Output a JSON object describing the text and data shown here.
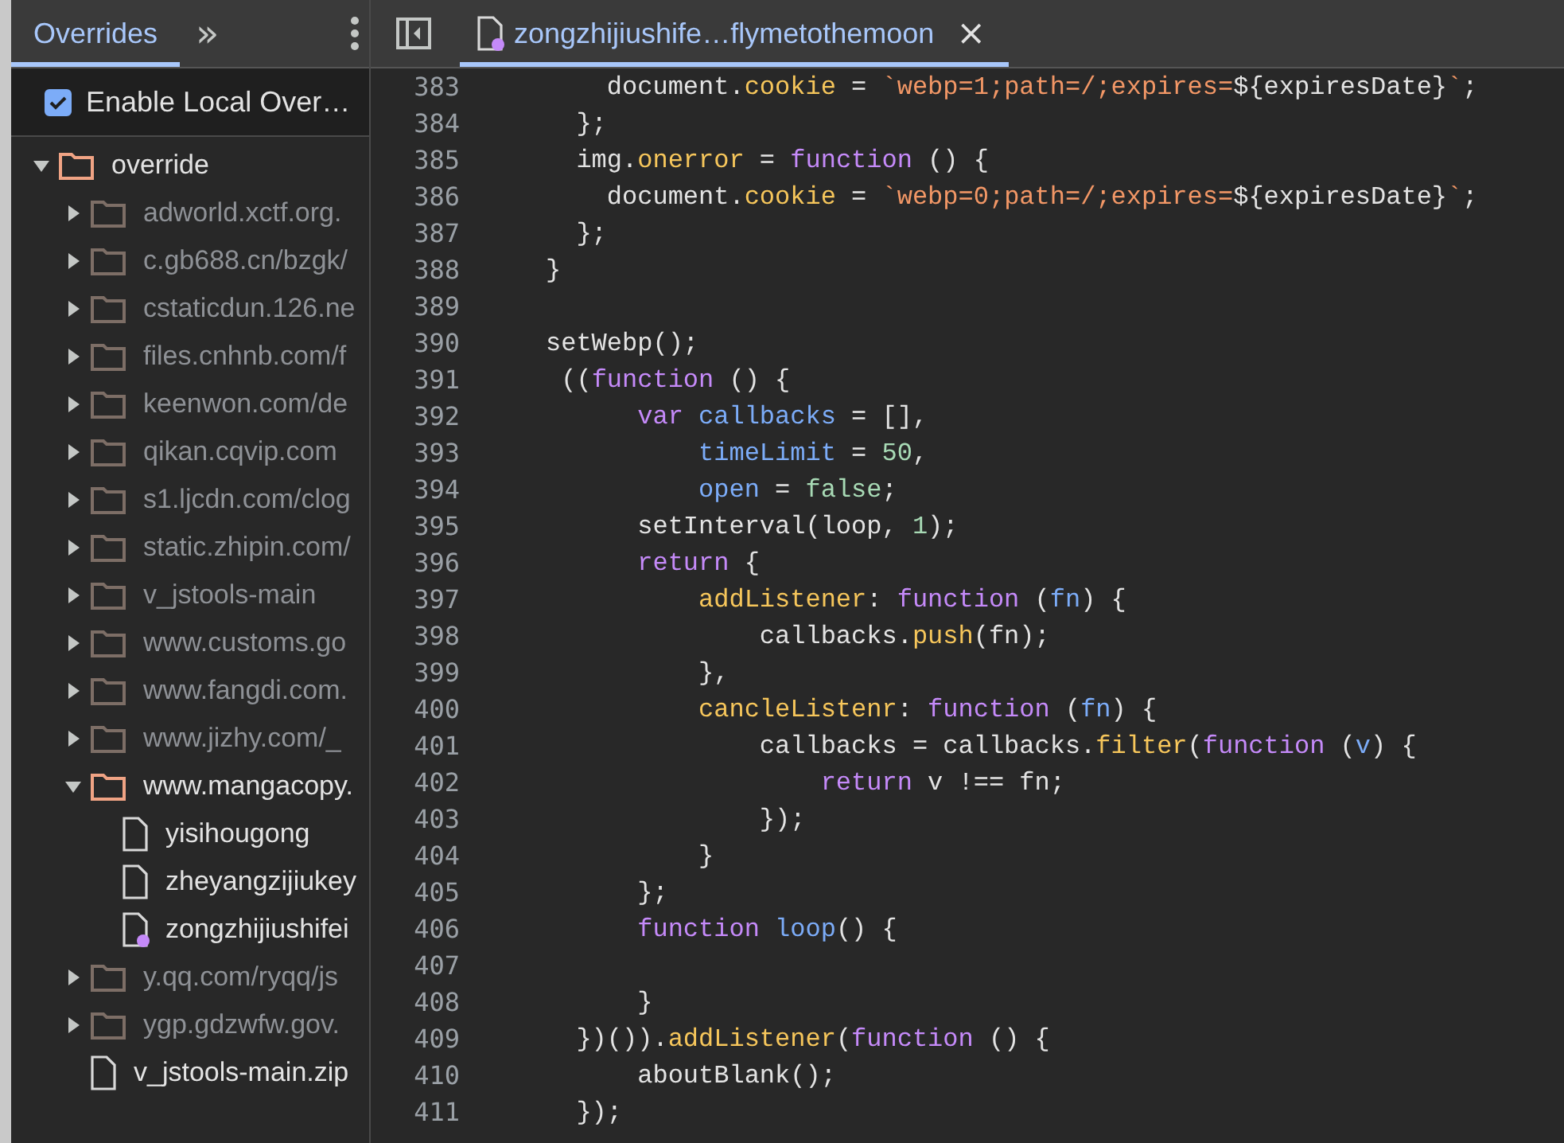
{
  "sidebar": {
    "tabs": [
      {
        "label": "Overrides",
        "selected": true
      }
    ],
    "more_tabs": "»",
    "enable_overrides": {
      "label": "Enable Local Over…",
      "checked": true
    },
    "tree": [
      {
        "kind": "folder",
        "name": "override",
        "expanded": true,
        "dimmed": false,
        "children": [
          {
            "kind": "folder",
            "name": "adworld.xctf.org.",
            "expanded": false,
            "dimmed": true
          },
          {
            "kind": "folder",
            "name": "c.gb688.cn/bzgk/",
            "expanded": false,
            "dimmed": true
          },
          {
            "kind": "folder",
            "name": "cstaticdun.126.ne",
            "expanded": false,
            "dimmed": true
          },
          {
            "kind": "folder",
            "name": "files.cnhnb.com/f",
            "expanded": false,
            "dimmed": true
          },
          {
            "kind": "folder",
            "name": "keenwon.com/de",
            "expanded": false,
            "dimmed": true
          },
          {
            "kind": "folder",
            "name": "qikan.cqvip.com",
            "expanded": false,
            "dimmed": true
          },
          {
            "kind": "folder",
            "name": "s1.ljcdn.com/clog",
            "expanded": false,
            "dimmed": true
          },
          {
            "kind": "folder",
            "name": "static.zhipin.com/",
            "expanded": false,
            "dimmed": true
          },
          {
            "kind": "folder",
            "name": "v_jstools-main",
            "expanded": false,
            "dimmed": true
          },
          {
            "kind": "folder",
            "name": "www.customs.go",
            "expanded": false,
            "dimmed": true
          },
          {
            "kind": "folder",
            "name": "www.fangdi.com.",
            "expanded": false,
            "dimmed": true
          },
          {
            "kind": "folder",
            "name": "www.jizhy.com/_",
            "expanded": false,
            "dimmed": true
          },
          {
            "kind": "folder",
            "name": "www.mangacopy.",
            "expanded": true,
            "dimmed": false,
            "children": [
              {
                "kind": "file",
                "name": "yisihougong",
                "modified": false,
                "dimmed": false
              },
              {
                "kind": "file",
                "name": "zheyangzijiukey",
                "modified": false,
                "dimmed": false
              },
              {
                "kind": "file",
                "name": "zongzhijiushifei",
                "modified": true,
                "dimmed": false
              }
            ]
          },
          {
            "kind": "folder",
            "name": "y.qq.com/ryqq/js",
            "expanded": false,
            "dimmed": true
          },
          {
            "kind": "folder",
            "name": "ygp.gdzwfw.gov.",
            "expanded": false,
            "dimmed": true
          },
          {
            "kind": "file",
            "name": "v_jstools-main.zip",
            "modified": false,
            "dimmed": false
          }
        ]
      }
    ]
  },
  "editor": {
    "tabs": [
      {
        "label": "zongzhijiushife…flymetothemoon",
        "selected": true,
        "modified": true,
        "close": "×"
      }
    ],
    "lines": [
      {
        "number": "383",
        "tokens": [
          {
            "kind": "plain",
            "text": "    document."
          },
          {
            "kind": "prop",
            "text": "cookie"
          },
          {
            "kind": "plain",
            "text": " = "
          },
          {
            "kind": "string",
            "text": "`webp=1;path=/;expires="
          },
          {
            "kind": "plain",
            "text": "${expiresDate}"
          },
          {
            "kind": "string",
            "text": "`"
          },
          {
            "kind": "plain",
            "text": ";"
          }
        ]
      },
      {
        "number": "384",
        "tokens": [
          {
            "kind": "plain",
            "text": "  };"
          }
        ]
      },
      {
        "number": "385",
        "tokens": [
          {
            "kind": "plain",
            "text": "  img."
          },
          {
            "kind": "prop",
            "text": "onerror"
          },
          {
            "kind": "plain",
            "text": " = "
          },
          {
            "kind": "keyword",
            "text": "function"
          },
          {
            "kind": "plain",
            "text": " () {"
          }
        ]
      },
      {
        "number": "386",
        "tokens": [
          {
            "kind": "plain",
            "text": "    document."
          },
          {
            "kind": "prop",
            "text": "cookie"
          },
          {
            "kind": "plain",
            "text": " = "
          },
          {
            "kind": "string",
            "text": "`webp=0;path=/;expires="
          },
          {
            "kind": "plain",
            "text": "${expiresDate}"
          },
          {
            "kind": "string",
            "text": "`"
          },
          {
            "kind": "plain",
            "text": ";"
          }
        ]
      },
      {
        "number": "387",
        "tokens": [
          {
            "kind": "plain",
            "text": "  };"
          }
        ]
      },
      {
        "number": "388",
        "tokens": [
          {
            "kind": "plain",
            "text": "}"
          }
        ]
      },
      {
        "number": "389"
      },
      {
        "number": "390",
        "tokens": [
          {
            "kind": "plain",
            "text": "setWebp();"
          }
        ]
      },
      {
        "number": "391",
        "tokens": [
          {
            "kind": "plain",
            "text": " (("
          },
          {
            "kind": "keyword",
            "text": "function"
          },
          {
            "kind": "plain",
            "text": " () {"
          }
        ]
      },
      {
        "number": "392",
        "tokens": [
          {
            "kind": "keyword",
            "text": "      var"
          },
          {
            "kind": "var",
            "text": " callbacks"
          },
          {
            "kind": "plain",
            "text": " = [],"
          }
        ]
      },
      {
        "number": "393",
        "tokens": [
          {
            "kind": "var",
            "text": "          timeLimit"
          },
          {
            "kind": "plain",
            "text": " = "
          },
          {
            "kind": "number",
            "text": "50"
          },
          {
            "kind": "plain",
            "text": ","
          }
        ]
      },
      {
        "number": "394",
        "tokens": [
          {
            "kind": "var",
            "text": "          open"
          },
          {
            "kind": "plain",
            "text": " = "
          },
          {
            "kind": "number",
            "text": "false"
          },
          {
            "kind": "plain",
            "text": ";"
          }
        ]
      },
      {
        "number": "395",
        "tokens": [
          {
            "kind": "plain",
            "text": "      setInterval(loop, "
          },
          {
            "kind": "number",
            "text": "1"
          },
          {
            "kind": "plain",
            "text": ");"
          }
        ]
      },
      {
        "number": "396",
        "tokens": [
          {
            "kind": "keyword",
            "text": "      return"
          },
          {
            "kind": "plain",
            "text": " {"
          }
        ]
      },
      {
        "number": "397",
        "tokens": [
          {
            "kind": "prop",
            "text": "          addListener"
          },
          {
            "kind": "plain",
            "text": ": "
          },
          {
            "kind": "keyword",
            "text": "function"
          },
          {
            "kind": "plain",
            "text": " ("
          },
          {
            "kind": "var",
            "text": "fn"
          },
          {
            "kind": "plain",
            "text": ") {"
          }
        ]
      },
      {
        "number": "398",
        "tokens": [
          {
            "kind": "plain",
            "text": "              callbacks."
          },
          {
            "kind": "prop",
            "text": "push"
          },
          {
            "kind": "plain",
            "text": "(fn);"
          }
        ]
      },
      {
        "number": "399",
        "tokens": [
          {
            "kind": "plain",
            "text": "          },"
          }
        ]
      },
      {
        "number": "400",
        "tokens": [
          {
            "kind": "prop",
            "text": "          cancleListenr"
          },
          {
            "kind": "plain",
            "text": ": "
          },
          {
            "kind": "keyword",
            "text": "function"
          },
          {
            "kind": "plain",
            "text": " ("
          },
          {
            "kind": "var",
            "text": "fn"
          },
          {
            "kind": "plain",
            "text": ") {"
          }
        ]
      },
      {
        "number": "401",
        "tokens": [
          {
            "kind": "plain",
            "text": "              callbacks = callbacks."
          },
          {
            "kind": "prop",
            "text": "filter"
          },
          {
            "kind": "plain",
            "text": "("
          },
          {
            "kind": "keyword",
            "text": "function"
          },
          {
            "kind": "plain",
            "text": " ("
          },
          {
            "kind": "var",
            "text": "v"
          },
          {
            "kind": "plain",
            "text": ") {"
          }
        ]
      },
      {
        "number": "402",
        "tokens": [
          {
            "kind": "keyword",
            "text": "                  return"
          },
          {
            "kind": "plain",
            "text": " v !== fn;"
          }
        ]
      },
      {
        "number": "403",
        "tokens": [
          {
            "kind": "plain",
            "text": "              });"
          }
        ]
      },
      {
        "number": "404",
        "tokens": [
          {
            "kind": "plain",
            "text": "          }"
          }
        ]
      },
      {
        "number": "405",
        "tokens": [
          {
            "kind": "plain",
            "text": "      };"
          }
        ]
      },
      {
        "number": "406",
        "tokens": [
          {
            "kind": "keyword",
            "text": "      function"
          },
          {
            "kind": "var",
            "text": " loop"
          },
          {
            "kind": "plain",
            "text": "() {"
          }
        ]
      },
      {
        "number": "407"
      },
      {
        "number": "408",
        "tokens": [
          {
            "kind": "plain",
            "text": "      }"
          }
        ]
      },
      {
        "number": "409",
        "tokens": [
          {
            "kind": "plain",
            "text": "  })())."
          },
          {
            "kind": "prop",
            "text": "addListener"
          },
          {
            "kind": "plain",
            "text": "("
          },
          {
            "kind": "keyword",
            "text": "function"
          },
          {
            "kind": "plain",
            "text": " () {"
          }
        ]
      },
      {
        "number": "410",
        "tokens": [
          {
            "kind": "plain",
            "text": "      aboutBlank();"
          }
        ]
      },
      {
        "number": "411",
        "tokens": [
          {
            "kind": "plain",
            "text": "  });"
          }
        ]
      }
    ]
  }
}
